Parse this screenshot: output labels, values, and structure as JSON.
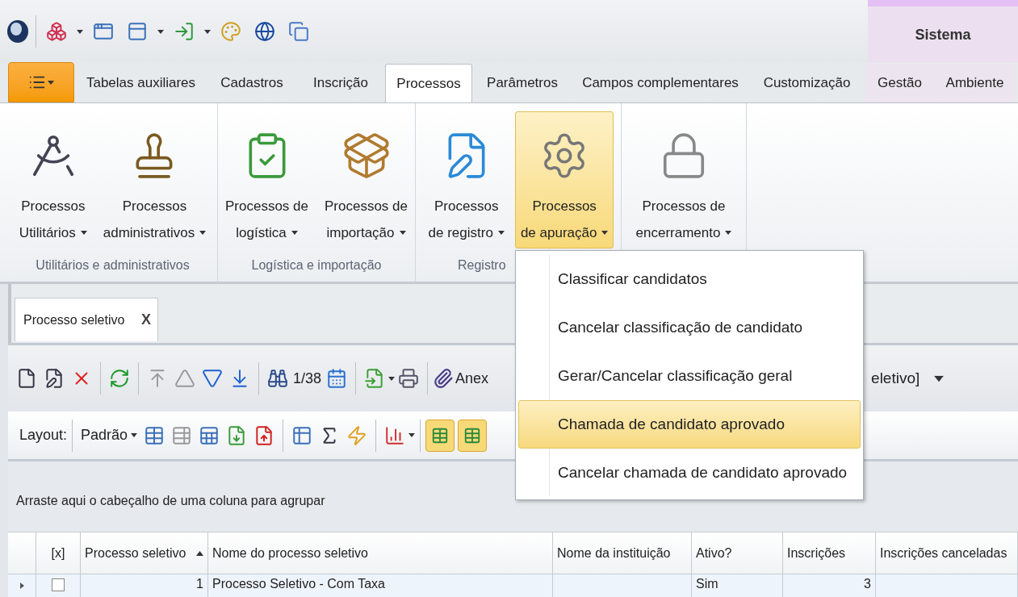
{
  "context_group": {
    "label": "Sistema"
  },
  "tabs": [
    {
      "label": "Tabelas auxiliares",
      "selected": false
    },
    {
      "label": "Cadastros",
      "selected": false
    },
    {
      "label": "Inscrição",
      "selected": false
    },
    {
      "label": "Processos",
      "selected": true
    },
    {
      "label": "Parâmetros",
      "selected": false
    },
    {
      "label": "Campos complementares",
      "selected": false
    },
    {
      "label": "Customização",
      "selected": false
    },
    {
      "label": "Gestão",
      "selected": false
    },
    {
      "label": "Ambiente",
      "selected": false
    }
  ],
  "ribbon_groups": [
    {
      "label": "Utilitários e administrativos",
      "buttons": [
        {
          "kind": "compass",
          "lines": [
            "Processos",
            "Utilitários"
          ],
          "selected": false
        },
        {
          "kind": "stamp",
          "lines": [
            "Processos",
            "administrativos"
          ],
          "selected": false
        }
      ]
    },
    {
      "label": "Logística e importação",
      "buttons": [
        {
          "kind": "checklist",
          "lines": [
            "Processos de",
            "logística"
          ],
          "selected": false
        },
        {
          "kind": "import",
          "lines": [
            "Processos de",
            "importação"
          ],
          "selected": false
        }
      ]
    },
    {
      "label": "Registro",
      "buttons": [
        {
          "kind": "register",
          "lines": [
            "Processos",
            "de registro"
          ],
          "selected": false
        },
        {
          "kind": "gears",
          "lines": [
            "Processos",
            "de apuração"
          ],
          "selected": true
        }
      ]
    },
    {
      "buttons": [
        {
          "kind": "lock",
          "lines": [
            "Processos de",
            "encerramento"
          ],
          "selected": false
        }
      ]
    }
  ],
  "document_tab": {
    "label": "Processo seletivo",
    "close": "X"
  },
  "toolbar": {
    "record_counter": "1/38",
    "attachments": "Anex",
    "attachments_tail": "eletivo]"
  },
  "layout_bar": {
    "label": "Layout:",
    "layout": "Padrão",
    "toggles": [
      {
        "selected": true
      },
      {
        "selected": true
      }
    ]
  },
  "group_panel": {
    "hint": "Arraste aqui o cabeçalho de uma coluna para agrupar"
  },
  "grid": {
    "columns": [
      {
        "label": "[x]",
        "sorted_ascending": false
      },
      {
        "label": "Processo seletivo",
        "sorted_ascending": true
      },
      {
        "label": "Nome do processo seletivo",
        "sorted_ascending": false
      },
      {
        "label": "Nome da instituição",
        "sorted_ascending": false
      },
      {
        "label": "Ativo?",
        "sorted_ascending": false
      },
      {
        "label": "Inscrições",
        "sorted_ascending": false
      },
      {
        "label": "Inscrições canceladas",
        "sorted_ascending": false
      }
    ],
    "rows": [
      {
        "checked": false,
        "cells": [
          "",
          "1",
          "Processo Seletivo - Com Taxa",
          "",
          "Sim",
          "3",
          ""
        ]
      }
    ]
  },
  "dropdown_menu": {
    "items": [
      {
        "label": "Classificar candidatos",
        "selected": false
      },
      {
        "label": "Cancelar classificação de candidato",
        "selected": false
      },
      {
        "label": "Gerar/Cancelar classificação geral",
        "selected": false
      },
      {
        "label": "Chamada de candidato aprovado",
        "selected": true
      },
      {
        "label": "Cancelar chamada de candidato aprovado",
        "selected": false
      }
    ]
  }
}
